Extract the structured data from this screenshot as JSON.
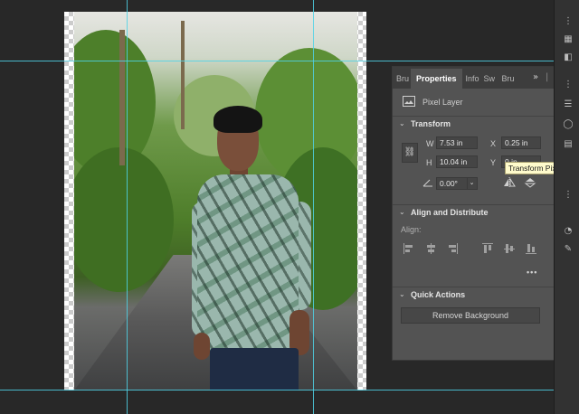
{
  "panel": {
    "tabs": [
      "Bru",
      "Properties",
      "Info",
      "Sw",
      "Bru"
    ],
    "menu_label": "»",
    "layer_type": "Pixel Layer",
    "transform": {
      "heading": "Transform",
      "w_label": "W",
      "w_value": "7.53 in",
      "h_label": "H",
      "h_value": "10.04 in",
      "x_label": "X",
      "x_value": "0.25 in",
      "y_label": "Y",
      "y_value": "0 in",
      "angle_value": "0.00°"
    },
    "align": {
      "heading": "Align and Distribute",
      "align_label": "Align:",
      "more_label": "•••"
    },
    "quick_actions": {
      "heading": "Quick Actions",
      "remove_bg_label": "Remove Background"
    }
  },
  "tooltip": "Transform Pixel Layer",
  "colors": {
    "guide": "#4fd2e6",
    "panel_bg": "#535353",
    "app_bg": "#282828"
  }
}
